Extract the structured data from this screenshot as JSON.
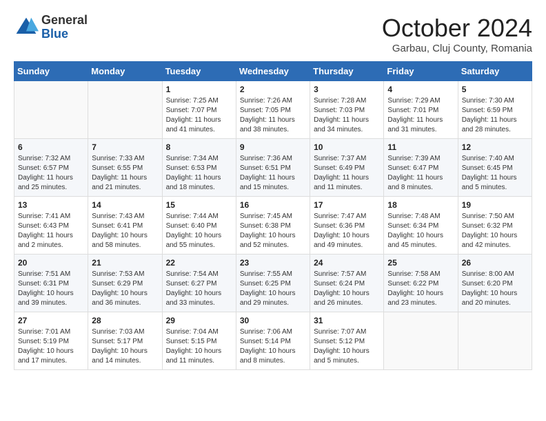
{
  "header": {
    "logo_line1": "General",
    "logo_line2": "Blue",
    "month": "October 2024",
    "location": "Garbau, Cluj County, Romania"
  },
  "weekdays": [
    "Sunday",
    "Monday",
    "Tuesday",
    "Wednesday",
    "Thursday",
    "Friday",
    "Saturday"
  ],
  "weeks": [
    [
      {
        "day": "",
        "sunrise": "",
        "sunset": "",
        "daylight": ""
      },
      {
        "day": "",
        "sunrise": "",
        "sunset": "",
        "daylight": ""
      },
      {
        "day": "1",
        "sunrise": "Sunrise: 7:25 AM",
        "sunset": "Sunset: 7:07 PM",
        "daylight": "Daylight: 11 hours and 41 minutes."
      },
      {
        "day": "2",
        "sunrise": "Sunrise: 7:26 AM",
        "sunset": "Sunset: 7:05 PM",
        "daylight": "Daylight: 11 hours and 38 minutes."
      },
      {
        "day": "3",
        "sunrise": "Sunrise: 7:28 AM",
        "sunset": "Sunset: 7:03 PM",
        "daylight": "Daylight: 11 hours and 34 minutes."
      },
      {
        "day": "4",
        "sunrise": "Sunrise: 7:29 AM",
        "sunset": "Sunset: 7:01 PM",
        "daylight": "Daylight: 11 hours and 31 minutes."
      },
      {
        "day": "5",
        "sunrise": "Sunrise: 7:30 AM",
        "sunset": "Sunset: 6:59 PM",
        "daylight": "Daylight: 11 hours and 28 minutes."
      }
    ],
    [
      {
        "day": "6",
        "sunrise": "Sunrise: 7:32 AM",
        "sunset": "Sunset: 6:57 PM",
        "daylight": "Daylight: 11 hours and 25 minutes."
      },
      {
        "day": "7",
        "sunrise": "Sunrise: 7:33 AM",
        "sunset": "Sunset: 6:55 PM",
        "daylight": "Daylight: 11 hours and 21 minutes."
      },
      {
        "day": "8",
        "sunrise": "Sunrise: 7:34 AM",
        "sunset": "Sunset: 6:53 PM",
        "daylight": "Daylight: 11 hours and 18 minutes."
      },
      {
        "day": "9",
        "sunrise": "Sunrise: 7:36 AM",
        "sunset": "Sunset: 6:51 PM",
        "daylight": "Daylight: 11 hours and 15 minutes."
      },
      {
        "day": "10",
        "sunrise": "Sunrise: 7:37 AM",
        "sunset": "Sunset: 6:49 PM",
        "daylight": "Daylight: 11 hours and 11 minutes."
      },
      {
        "day": "11",
        "sunrise": "Sunrise: 7:39 AM",
        "sunset": "Sunset: 6:47 PM",
        "daylight": "Daylight: 11 hours and 8 minutes."
      },
      {
        "day": "12",
        "sunrise": "Sunrise: 7:40 AM",
        "sunset": "Sunset: 6:45 PM",
        "daylight": "Daylight: 11 hours and 5 minutes."
      }
    ],
    [
      {
        "day": "13",
        "sunrise": "Sunrise: 7:41 AM",
        "sunset": "Sunset: 6:43 PM",
        "daylight": "Daylight: 11 hours and 2 minutes."
      },
      {
        "day": "14",
        "sunrise": "Sunrise: 7:43 AM",
        "sunset": "Sunset: 6:41 PM",
        "daylight": "Daylight: 10 hours and 58 minutes."
      },
      {
        "day": "15",
        "sunrise": "Sunrise: 7:44 AM",
        "sunset": "Sunset: 6:40 PM",
        "daylight": "Daylight: 10 hours and 55 minutes."
      },
      {
        "day": "16",
        "sunrise": "Sunrise: 7:45 AM",
        "sunset": "Sunset: 6:38 PM",
        "daylight": "Daylight: 10 hours and 52 minutes."
      },
      {
        "day": "17",
        "sunrise": "Sunrise: 7:47 AM",
        "sunset": "Sunset: 6:36 PM",
        "daylight": "Daylight: 10 hours and 49 minutes."
      },
      {
        "day": "18",
        "sunrise": "Sunrise: 7:48 AM",
        "sunset": "Sunset: 6:34 PM",
        "daylight": "Daylight: 10 hours and 45 minutes."
      },
      {
        "day": "19",
        "sunrise": "Sunrise: 7:50 AM",
        "sunset": "Sunset: 6:32 PM",
        "daylight": "Daylight: 10 hours and 42 minutes."
      }
    ],
    [
      {
        "day": "20",
        "sunrise": "Sunrise: 7:51 AM",
        "sunset": "Sunset: 6:31 PM",
        "daylight": "Daylight: 10 hours and 39 minutes."
      },
      {
        "day": "21",
        "sunrise": "Sunrise: 7:53 AM",
        "sunset": "Sunset: 6:29 PM",
        "daylight": "Daylight: 10 hours and 36 minutes."
      },
      {
        "day": "22",
        "sunrise": "Sunrise: 7:54 AM",
        "sunset": "Sunset: 6:27 PM",
        "daylight": "Daylight: 10 hours and 33 minutes."
      },
      {
        "day": "23",
        "sunrise": "Sunrise: 7:55 AM",
        "sunset": "Sunset: 6:25 PM",
        "daylight": "Daylight: 10 hours and 29 minutes."
      },
      {
        "day": "24",
        "sunrise": "Sunrise: 7:57 AM",
        "sunset": "Sunset: 6:24 PM",
        "daylight": "Daylight: 10 hours and 26 minutes."
      },
      {
        "day": "25",
        "sunrise": "Sunrise: 7:58 AM",
        "sunset": "Sunset: 6:22 PM",
        "daylight": "Daylight: 10 hours and 23 minutes."
      },
      {
        "day": "26",
        "sunrise": "Sunrise: 8:00 AM",
        "sunset": "Sunset: 6:20 PM",
        "daylight": "Daylight: 10 hours and 20 minutes."
      }
    ],
    [
      {
        "day": "27",
        "sunrise": "Sunrise: 7:01 AM",
        "sunset": "Sunset: 5:19 PM",
        "daylight": "Daylight: 10 hours and 17 minutes."
      },
      {
        "day": "28",
        "sunrise": "Sunrise: 7:03 AM",
        "sunset": "Sunset: 5:17 PM",
        "daylight": "Daylight: 10 hours and 14 minutes."
      },
      {
        "day": "29",
        "sunrise": "Sunrise: 7:04 AM",
        "sunset": "Sunset: 5:15 PM",
        "daylight": "Daylight: 10 hours and 11 minutes."
      },
      {
        "day": "30",
        "sunrise": "Sunrise: 7:06 AM",
        "sunset": "Sunset: 5:14 PM",
        "daylight": "Daylight: 10 hours and 8 minutes."
      },
      {
        "day": "31",
        "sunrise": "Sunrise: 7:07 AM",
        "sunset": "Sunset: 5:12 PM",
        "daylight": "Daylight: 10 hours and 5 minutes."
      },
      {
        "day": "",
        "sunrise": "",
        "sunset": "",
        "daylight": ""
      },
      {
        "day": "",
        "sunrise": "",
        "sunset": "",
        "daylight": ""
      }
    ]
  ]
}
